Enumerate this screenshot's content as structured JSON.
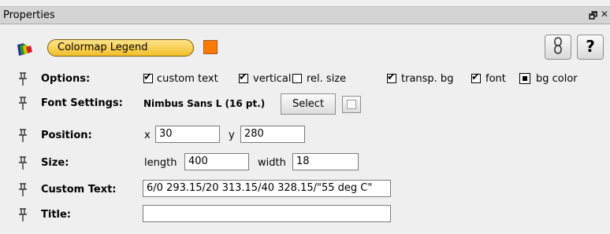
{
  "window": {
    "title": "Properties",
    "controls": [
      "🗗",
      "✕"
    ]
  },
  "header": {
    "module_name": "Colormap Legend",
    "module_color": "#ff7a00",
    "link_icon": "chain-link-icon",
    "help_label": "?"
  },
  "options": {
    "label": "Options:",
    "items": [
      {
        "label": "custom text",
        "checked": true
      },
      {
        "label": "vertical",
        "checked": true
      },
      {
        "label": "rel. size",
        "checked": false
      },
      {
        "label": "transp. bg",
        "checked": true
      },
      {
        "label": "font",
        "checked": true
      },
      {
        "label": "bg color",
        "checked": false
      }
    ]
  },
  "font_settings": {
    "label": "Font Settings:",
    "font_name": "Nimbus Sans L (16 pt.)",
    "select_label": "Select"
  },
  "position": {
    "label": "Position:",
    "x_label": "x",
    "x_value": "30",
    "y_label": "y",
    "y_value": "280"
  },
  "size": {
    "label": "Size:",
    "length_label": "length",
    "length_value": "400",
    "width_label": "width",
    "width_value": "18"
  },
  "custom_text": {
    "label": "Custom Text:",
    "value": "6/0 293.15/20 313.15/40 328.15/\"55 deg C\""
  },
  "title_field": {
    "label": "Title:",
    "value": ""
  }
}
